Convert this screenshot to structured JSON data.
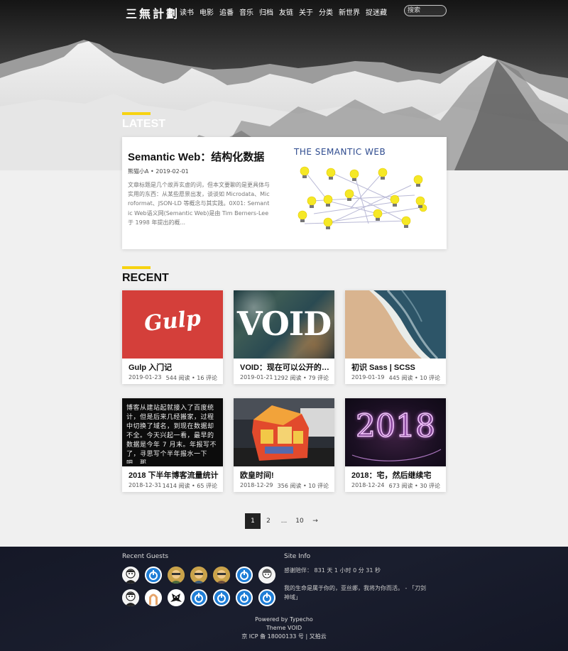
{
  "nav": {
    "logo": "三無計劃",
    "links": [
      "读书",
      "电影",
      "追番",
      "音乐",
      "归档",
      "友链",
      "关于",
      "分类",
      "新世界",
      "捉迷藏"
    ],
    "search_placeholder": "搜索"
  },
  "latest": {
    "heading": "LATEST",
    "post": {
      "title": "Semantic Web：结构化数据",
      "meta": "熊猫小A • 2019-02-01",
      "excerpt": "文章标题是几个故弄玄虚的词，但本文要聊的是更具体与实用的东西：从某些愿景出发，谈谈如 Microdata、Microformat、JSON-LD 等概念与其实践。0X01: Semantic Web语义网(Semantic Web)是由 Tim Berners-Lee 于 1998 年提出的概...",
      "image_caption": "THE SEMANTIC WEB"
    }
  },
  "recent": {
    "heading": "RECENT",
    "posts": [
      {
        "title": "Gulp 入门记",
        "date": "2019-01-23",
        "stats": "544 阅读 • 16 评论",
        "thumb_text": "Gulp"
      },
      {
        "title": "VOID：现在可以公开的情报",
        "date": "2019-01-21",
        "stats": "1292 阅读 • 79 评论",
        "thumb_text": "VOID"
      },
      {
        "title": "初识 Sass | SCSS",
        "date": "2019-01-19",
        "stats": "445 阅读 • 10 评论",
        "thumb_text": ""
      },
      {
        "title": "2018 下半年博客流量统计",
        "date": "2018-12-31",
        "stats": "1414 阅读 • 65 评论",
        "thumb_text": "博客从建站起就接入了百度统计，但是后来几经搬家，过程中切换了域名，到现在数据却不全。今天兴起一看，最早的数据是今年 7 月末。年报写不了，寻思写个半年报水一下吧。那"
      },
      {
        "title": "欧皇时间!",
        "date": "2018-12-29",
        "stats": "356 阅读 • 10 评论",
        "thumb_text": ""
      },
      {
        "title": "2018：宅，然后继续宅",
        "date": "2018-12-24",
        "stats": "673 阅读 • 30 评论",
        "thumb_text": "2018"
      }
    ]
  },
  "pagination": {
    "items": [
      "1",
      "2",
      "...",
      "10",
      "→"
    ],
    "active": "1"
  },
  "footer": {
    "guests_title": "Recent Guests",
    "siteinfo_title": "Site Info",
    "days": "感谢陪伴： 831 天 1 小时 0 分 31 秒",
    "quote": "我的生命是属于你的，亚丝娜，我将为你而活。 - 「刀剑神域」",
    "powered": "Powered by Typecho",
    "theme": "Theme VOID",
    "icp": "京 ICP 备 18000133 号 | 又拍云"
  },
  "colors": {
    "accent": "#f7d310",
    "footer_bg": "#171b2a",
    "page_bg": "#f0f0f0",
    "gulp_red": "#d43f3a"
  }
}
